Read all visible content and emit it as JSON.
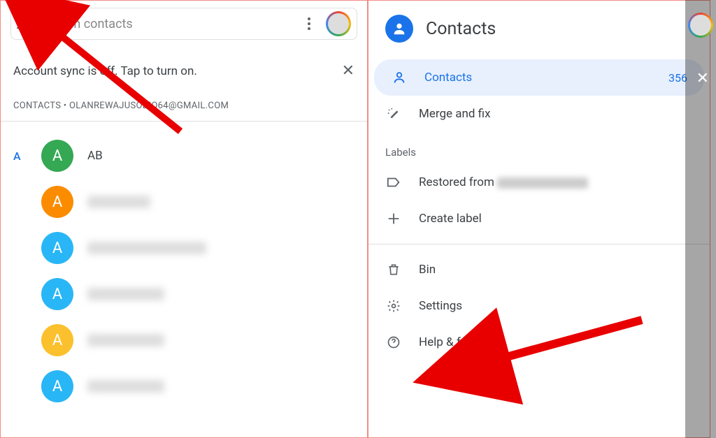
{
  "left": {
    "search_placeholder": "Search contacts",
    "banner": "Account sync is off. Tap to turn on.",
    "account_line": "CONTACTS • OLANREWAJUSODIQ64@GMAIL.COM",
    "index_letter": "A",
    "contacts": [
      {
        "initial": "A",
        "name": "AB",
        "color": "c-green",
        "blurred": false
      },
      {
        "initial": "A",
        "name": "",
        "color": "c-orange",
        "blurred": true,
        "w": "w100"
      },
      {
        "initial": "A",
        "name": "",
        "color": "c-cyan",
        "blurred": true,
        "w": "w180"
      },
      {
        "initial": "A",
        "name": "",
        "color": "c-cyan2",
        "blurred": true,
        "w": "w120"
      },
      {
        "initial": "A",
        "name": "",
        "color": "c-yellow",
        "blurred": true,
        "w": "w120"
      },
      {
        "initial": "A",
        "name": "",
        "color": "c-cyan3",
        "blurred": true,
        "w": "w120"
      }
    ]
  },
  "right": {
    "title": "Contacts",
    "items": {
      "contacts": {
        "label": "Contacts",
        "count": "356"
      },
      "merge": {
        "label": "Merge and fix"
      },
      "labels_section": "Labels",
      "restored": {
        "label": "Restored from"
      },
      "create": {
        "label": "Create label"
      },
      "bin": {
        "label": "Bin"
      },
      "settings": {
        "label": "Settings"
      },
      "help": {
        "label": "Help & feedback"
      }
    }
  }
}
